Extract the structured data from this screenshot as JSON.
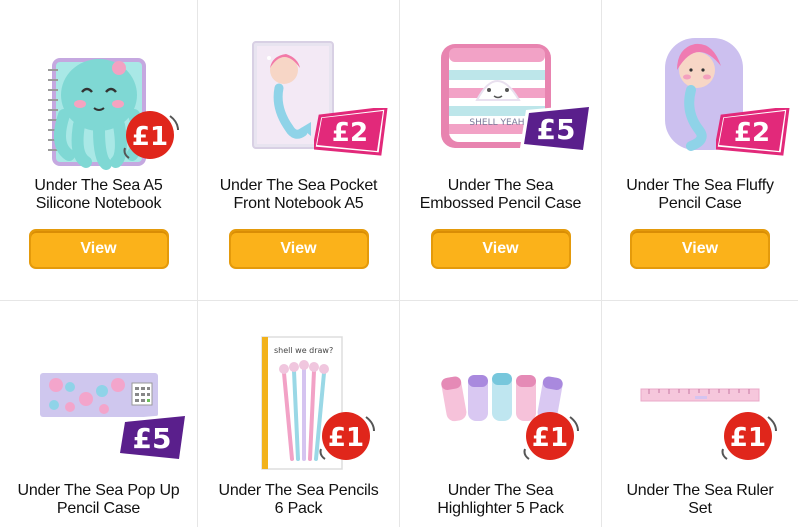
{
  "colors": {
    "button_bg": "#fbb21a",
    "button_border": "#e49a0b",
    "badge_red": "#e0261b",
    "badge_magenta": "#e2297a",
    "badge_purple": "#5a1f8c",
    "divider": "#e6e6e6"
  },
  "products": [
    {
      "title_line1": "Under The Sea A5",
      "title_line2": "Silicone Notebook",
      "price": "£1",
      "badge_style": "red-circle",
      "button_label": "View",
      "image_icon": "octopus-notebook"
    },
    {
      "title_line1": "Under The Sea Pocket",
      "title_line2": "Front Notebook A5",
      "price": "£2",
      "badge_style": "magenta-flag",
      "button_label": "View",
      "image_icon": "mermaid-notebook"
    },
    {
      "title_line1": "Under The Sea",
      "title_line2": "Embossed Pencil Case",
      "price": "£5",
      "badge_style": "purple-flag",
      "button_label": "View",
      "image_icon": "shell-pencil-case"
    },
    {
      "title_line1": "Under The Sea Fluffy",
      "title_line2": "Pencil Case",
      "price": "£2",
      "badge_style": "magenta-flag",
      "button_label": "View",
      "image_icon": "fluffy-mermaid-case"
    },
    {
      "title_line1": "Under The Sea Pop Up",
      "title_line2": "Pencil Case",
      "price": "£5",
      "badge_style": "purple-flag",
      "image_icon": "popup-pencil-case"
    },
    {
      "title_line1": "Under The Sea Pencils",
      "title_line2": "6 Pack",
      "price": "£1",
      "badge_style": "red-circle",
      "image_icon": "pencils-pack",
      "package_text": "shell we draw?"
    },
    {
      "title_line1": "Under The Sea",
      "title_line2": "Highlighter 5 Pack",
      "price": "£1",
      "badge_style": "red-circle",
      "image_icon": "highlighters"
    },
    {
      "title_line1": "Under The Sea Ruler",
      "title_line2": "Set",
      "price": "£1",
      "badge_style": "red-circle",
      "image_icon": "ruler-set"
    }
  ],
  "product3_print": "SHELL YEAH"
}
